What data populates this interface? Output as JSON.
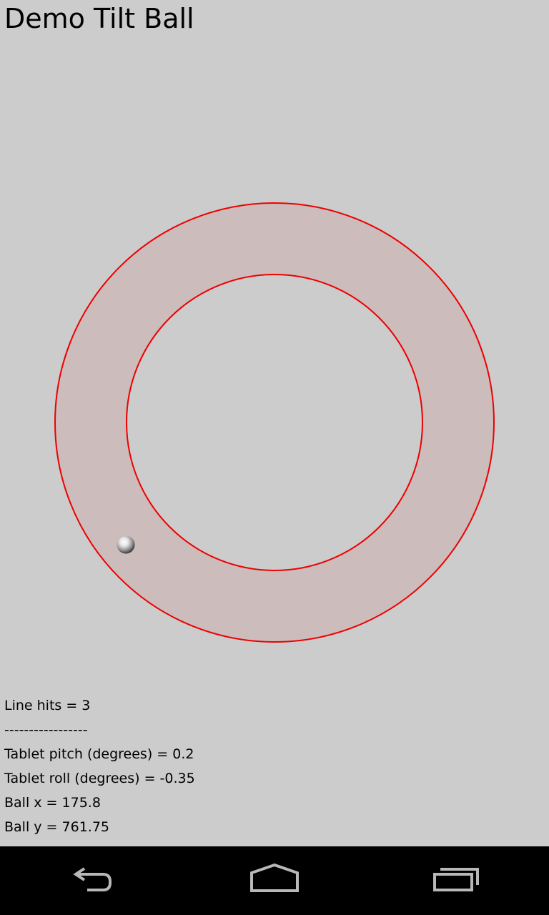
{
  "app": {
    "title": "Demo Tilt Ball"
  },
  "track": {
    "fill_color": "#ccbcbc",
    "line_color": "#ee0000",
    "ball_color": "#c8c8c8"
  },
  "readouts": {
    "line_hits": "Line hits = 3",
    "separator": "-----------------",
    "pitch": "Tablet pitch (degrees) = 0.2",
    "roll": "Tablet roll (degrees) = -0.35",
    "ball_x": "Ball x = 175.8",
    "ball_y": "Ball y = 761.75"
  },
  "navbar": {
    "buttons": [
      {
        "icon": "back-icon"
      },
      {
        "icon": "home-icon"
      },
      {
        "icon": "recents-icon"
      }
    ]
  }
}
